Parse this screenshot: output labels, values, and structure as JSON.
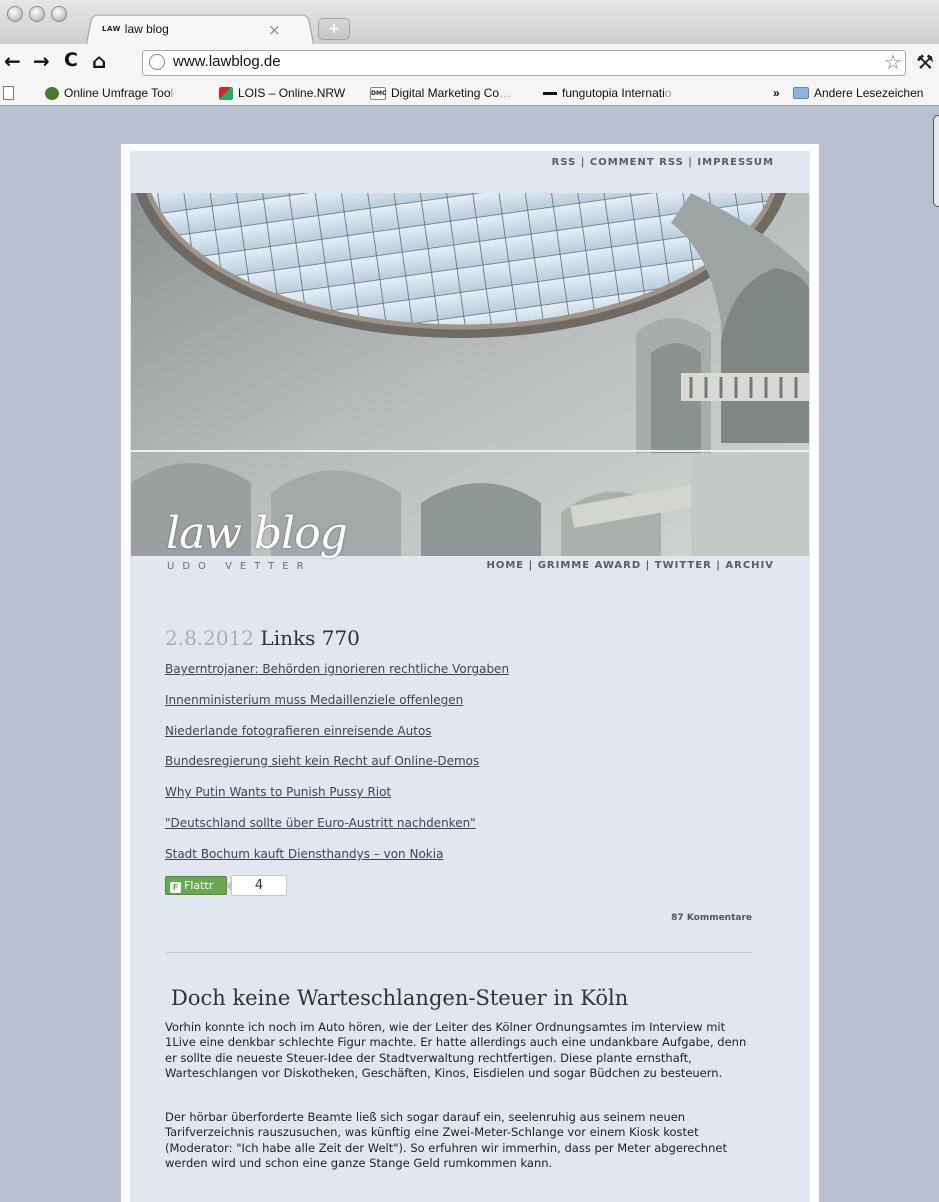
{
  "browser": {
    "tab_icon": "LAW",
    "tab_title": "law blog",
    "tab_close": "×",
    "new_tab": "+",
    "url": "www.lawblog.de"
  },
  "bookmarks": {
    "items": [
      {
        "label": "Online Umfrage Too",
        "fade": "l"
      },
      {
        "label": "LOIS – Online.NRW",
        "fade": ""
      },
      {
        "label": "Digital Marketing Co",
        "fade": "…"
      },
      {
        "label": "fungutopia Internati",
        "fade": "o"
      }
    ],
    "chevron": "»",
    "other": "Andere Lesezeichen"
  },
  "site": {
    "toplinks": "RSS | COMMENT RSS | IMPRESSUM",
    "logo_title": "law blog",
    "logo_subtitle": "UDO VETTER",
    "nav": "HOME | GRIMME AWARD | TWITTER | ARCHIV"
  },
  "post1": {
    "date": "2.8.2012",
    "title": "Links 770",
    "links": [
      "Bayerntrojaner: Behörden ignorieren rechtliche Vorgaben",
      "Innenministerium muss Medaillenziele offenlegen",
      "Niederlande fotografieren einreisende Autos",
      "Bundesregierung sieht kein Recht auf Online-Demos",
      "Why Putin Wants to Punish Pussy Riot",
      "\"Deutschland sollte über Euro-Austritt nachdenken\"",
      "Stadt Bochum kauft Diensthandys – von Nokia"
    ],
    "flattr_label": "Flattr",
    "flattr_count": "4",
    "comments": "87 Kommentare"
  },
  "post2": {
    "title": "Doch keine Warteschlangen-Steuer in Köln",
    "paragraph1": "Vorhin konnte ich noch im Auto hören, wie der Leiter des Kölner Ordnungsamtes im Interview mit 1Live eine denkbar schlechte Figur machte. Er hatte allerdings auch eine undankbare Aufgabe, denn er sollte die neueste Steuer-Idee der Stadtverwaltung rechtfertigen. Diese plante ernsthaft, Warteschlangen vor Diskotheken, Geschäften, Kinos, Eisdielen und sogar Büdchen zu besteuern.",
    "paragraph2": "Der hörbar überforderte Beamte ließ sich sogar darauf ein, seelenruhig aus seinem neuen Tarifverzeichnis rauszusuchen, was künftig eine Zwei-Meter-Schlange vor einem Kiosk kostet (Moderator: \"Ich habe alle Zeit der Welt\"). So erfuhren wir immerhin, dass per Meter abgerechnet werden wird und schon eine ganze Stange Geld rumkommen kann."
  }
}
